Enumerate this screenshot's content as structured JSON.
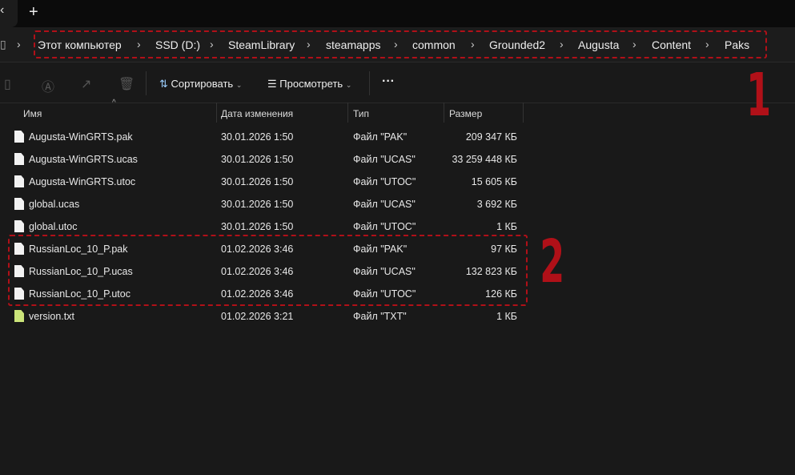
{
  "tabstrip": {
    "close": "×",
    "new_tab": "+"
  },
  "breadcrumb": [
    "Этот компьютер",
    "SSD (D:)",
    "SteamLibrary",
    "steamapps",
    "common",
    "Grounded2",
    "Augusta",
    "Content",
    "Paks"
  ],
  "toolbar": {
    "sort_label": "Сортировать",
    "view_label": "Просмотреть",
    "more": "···"
  },
  "columns": {
    "name": "Имя",
    "date": "Дата изменения",
    "type": "Тип",
    "size": "Размер"
  },
  "files": [
    {
      "name": "Augusta-WinGRTS.pak",
      "date": "30.01.2026 1:50",
      "type": "Файл \"PAK\"",
      "size": "209 347 КБ"
    },
    {
      "name": "Augusta-WinGRTS.ucas",
      "date": "30.01.2026 1:50",
      "type": "Файл \"UCAS\"",
      "size": "33 259 448 КБ"
    },
    {
      "name": "Augusta-WinGRTS.utoc",
      "date": "30.01.2026 1:50",
      "type": "Файл \"UTOC\"",
      "size": "15 605 КБ"
    },
    {
      "name": "global.ucas",
      "date": "30.01.2026 1:50",
      "type": "Файл \"UCAS\"",
      "size": "3 692 КБ"
    },
    {
      "name": "global.utoc",
      "date": "30.01.2026 1:50",
      "type": "Файл \"UTOC\"",
      "size": "1 КБ"
    },
    {
      "name": "RussianLoc_10_P.pak",
      "date": "01.02.2026 3:46",
      "type": "Файл \"PAK\"",
      "size": "97 КБ"
    },
    {
      "name": "RussianLoc_10_P.ucas",
      "date": "01.02.2026 3:46",
      "type": "Файл \"UCAS\"",
      "size": "132 823 КБ"
    },
    {
      "name": "RussianLoc_10_P.utoc",
      "date": "01.02.2026 3:46",
      "type": "Файл \"UTOC\"",
      "size": "126 КБ"
    },
    {
      "name": "version.txt",
      "date": "01.02.2026 3:21",
      "type": "Файл \"TXT\"",
      "size": "1 КБ"
    }
  ],
  "annotations": {
    "mark1": "1",
    "mark2": "2",
    "color": "#b01018"
  }
}
